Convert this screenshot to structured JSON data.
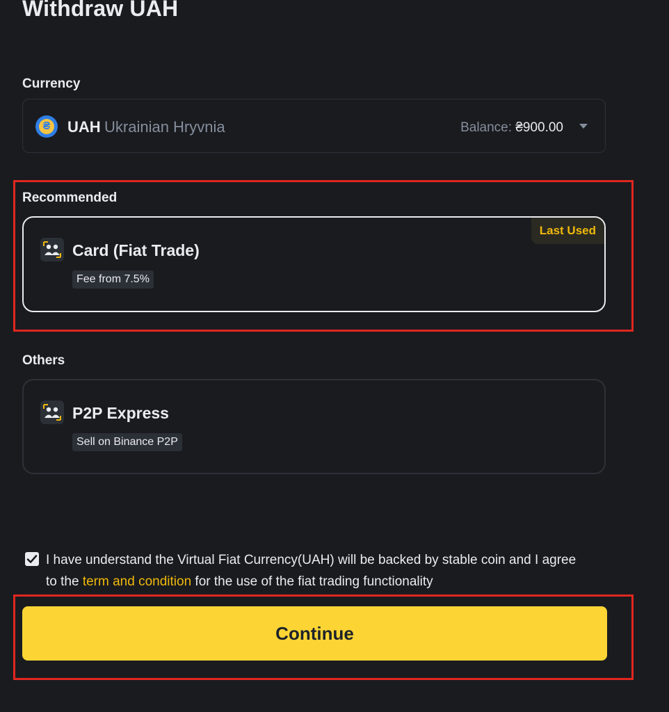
{
  "page": {
    "title": "Withdraw UAH"
  },
  "currency": {
    "label": "Currency",
    "code": "UAH",
    "name": "Ukrainian Hryvnia",
    "icon_glyph": "₴",
    "balance_label": "Balance: ",
    "balance_value": "₴900.00"
  },
  "recommended": {
    "label": "Recommended",
    "method": {
      "name": "Card (Fiat Trade)",
      "tag": "Fee from 7.5%",
      "badge": "Last Used",
      "icon": "p2p-people-icon"
    }
  },
  "others": {
    "label": "Others",
    "method": {
      "name": "P2P Express",
      "tag": "Sell on Binance P2P",
      "icon": "p2p-people-icon"
    }
  },
  "agreement": {
    "checked": true,
    "text_before": "I have understand the Virtual Fiat Currency(UAH) will be backed by stable coin and I agree to the ",
    "link_text": "term and condition",
    "text_after": " for the use of the fiat trading functionality"
  },
  "continue_label": "Continue",
  "colors": {
    "background": "#1a1b1f",
    "accent_yellow": "#fcd535",
    "link_yellow": "#f0b90b",
    "highlight_red": "#e0271f"
  }
}
